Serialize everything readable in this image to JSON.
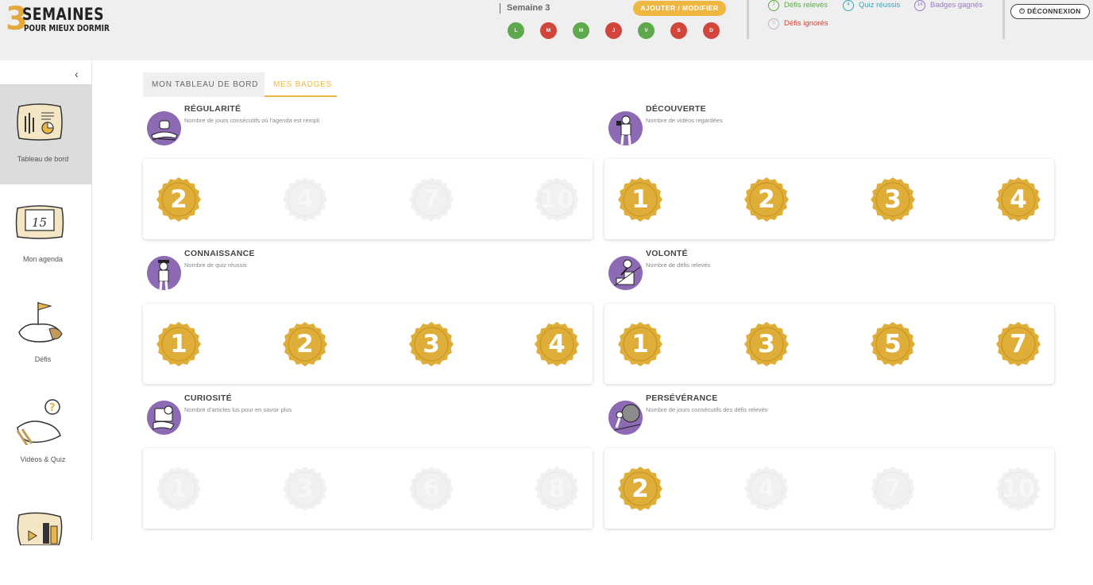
{
  "app": {
    "logo_number": "3",
    "logo_line1": "SEMAINES",
    "logo_line2": "POUR MIEUX DORMIR"
  },
  "header": {
    "week_label": "Semaine 3",
    "edit_button": "AJOUTER / MODIFIER",
    "days": [
      {
        "letter": "L",
        "status": "done",
        "color": "#5ea94c"
      },
      {
        "letter": "M",
        "status": "missed",
        "color": "#d1453b"
      },
      {
        "letter": "M",
        "status": "done",
        "color": "#5ea94c"
      },
      {
        "letter": "J",
        "status": "missed",
        "color": "#d1453b"
      },
      {
        "letter": "V",
        "status": "done",
        "color": "#5ea94c"
      },
      {
        "letter": "S",
        "status": "missed",
        "color": "#d1453b"
      },
      {
        "letter": "D",
        "status": "missed",
        "color": "#d1453b"
      }
    ],
    "stats": {
      "defis_releves": {
        "count": "7",
        "label": "Défis relevés",
        "color": "#5ea94c"
      },
      "quiz_reussis": {
        "count": "4",
        "label": "Quiz réussis",
        "color": "#3aa6b9"
      },
      "badges_gagnes": {
        "count": "14",
        "label": "Badges gagnés",
        "color": "#9a78c6"
      },
      "defis_ignores": {
        "count": "0",
        "label": "Défis ignorés",
        "color": "#d1453b"
      }
    },
    "logout_button": "DÉCONNEXION"
  },
  "sidebar": {
    "collapse_icon": "chevron-left-icon",
    "items": [
      {
        "label": "Tableau de bord",
        "icon": "dashboard-pillow-icon",
        "active": true
      },
      {
        "label": "Mon agenda",
        "icon": "calendar-pillow-icon",
        "active": false
      },
      {
        "label": "Défis",
        "icon": "flag-pillow-icon",
        "active": false
      },
      {
        "label": "Vidéos & Quiz",
        "icon": "question-pillow-icon",
        "active": false
      },
      {
        "label": "",
        "icon": "books-pillow-icon",
        "active": false
      }
    ]
  },
  "tabs": [
    {
      "label": "MON TABLEAU DE BORD",
      "active": false
    },
    {
      "label": "MES BADGES",
      "active": true
    }
  ],
  "badge_colors": {
    "earned": "#dfae38",
    "earned_dark": "#c99525",
    "locked": "#f1f1f1"
  },
  "sections": [
    {
      "title": "RÉGULARITÉ",
      "description": "Nombre de jours consécutifs où l'agenda est rempli",
      "icon": "sleeping-person-icon",
      "badges": [
        {
          "value": "2",
          "earned": true
        },
        {
          "value": "4",
          "earned": false
        },
        {
          "value": "7",
          "earned": false
        },
        {
          "value": "10",
          "earned": false
        }
      ]
    },
    {
      "title": "DÉCOUVERTE",
      "description": "Nombre de vidéos regardées",
      "icon": "person-watching-icon",
      "badges": [
        {
          "value": "1",
          "earned": true
        },
        {
          "value": "2",
          "earned": true
        },
        {
          "value": "3",
          "earned": true
        },
        {
          "value": "4",
          "earned": true
        }
      ]
    },
    {
      "title": "CONNAISSANCE",
      "description": "Nombre de quiz réussis",
      "icon": "graduate-person-icon",
      "badges": [
        {
          "value": "1",
          "earned": true
        },
        {
          "value": "2",
          "earned": true
        },
        {
          "value": "3",
          "earned": true
        },
        {
          "value": "4",
          "earned": true
        }
      ]
    },
    {
      "title": "VOLONTÉ",
      "description": "Nombre de défis relevés",
      "icon": "climbing-person-icon",
      "badges": [
        {
          "value": "1",
          "earned": true
        },
        {
          "value": "3",
          "earned": true
        },
        {
          "value": "5",
          "earned": true
        },
        {
          "value": "7",
          "earned": true
        }
      ]
    },
    {
      "title": "CURIOSITÉ",
      "description": "Nombre d'articles lus pour en savoir plus",
      "icon": "reading-person-icon",
      "badges": [
        {
          "value": "1",
          "earned": false
        },
        {
          "value": "3",
          "earned": false
        },
        {
          "value": "6",
          "earned": false
        },
        {
          "value": "8",
          "earned": false
        }
      ]
    },
    {
      "title": "PERSÉVÉRANCE",
      "description": "Nombre de jours consécutifs des défis relevés",
      "icon": "pushing-boulder-icon",
      "badges": [
        {
          "value": "2",
          "earned": true
        },
        {
          "value": "4",
          "earned": false
        },
        {
          "value": "7",
          "earned": false
        },
        {
          "value": "10",
          "earned": false
        }
      ]
    }
  ]
}
